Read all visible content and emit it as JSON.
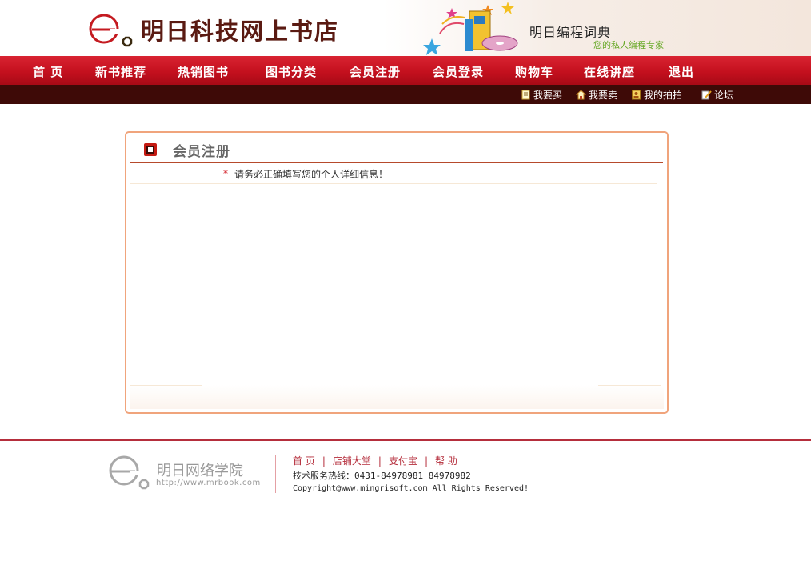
{
  "header": {
    "site_title": "明日科技网上书店",
    "promo_title": "明日编程词典",
    "promo_subtitle": "您的私人编程专家"
  },
  "nav": {
    "items": [
      "首 页",
      "新书推荐",
      "热销图书",
      "图书分类",
      "会员注册",
      "会员登录",
      "购物车",
      "在线讲座",
      "退出"
    ]
  },
  "subnav": {
    "items": [
      {
        "label": "我要买",
        "icon": "document-icon"
      },
      {
        "label": "我要卖",
        "icon": "house-icon"
      },
      {
        "label": "我的拍拍",
        "icon": "portrait-icon"
      },
      {
        "label": "论坛",
        "icon": "edit-note-icon"
      }
    ]
  },
  "panel": {
    "title": "会员注册",
    "required_star": "*",
    "notice": "请务必正确填写您的个人详细信息！"
  },
  "footer": {
    "org_name": "明日网络学院",
    "org_url": "http://www.mrbook.com",
    "links": [
      "首 页",
      "店铺大堂",
      "支付宝",
      "帮 助"
    ],
    "separator": "|",
    "hotline": "技术服务热线：0431-84978981  84978982",
    "copyright": "Copyright@www.mingrisoft.com All Rights Reserved!"
  },
  "colors": {
    "nav_red": "#c4101e",
    "subnav_dark": "#3e0a07",
    "panel_border": "#f0a47c",
    "footer_accent": "#b52e3c"
  }
}
